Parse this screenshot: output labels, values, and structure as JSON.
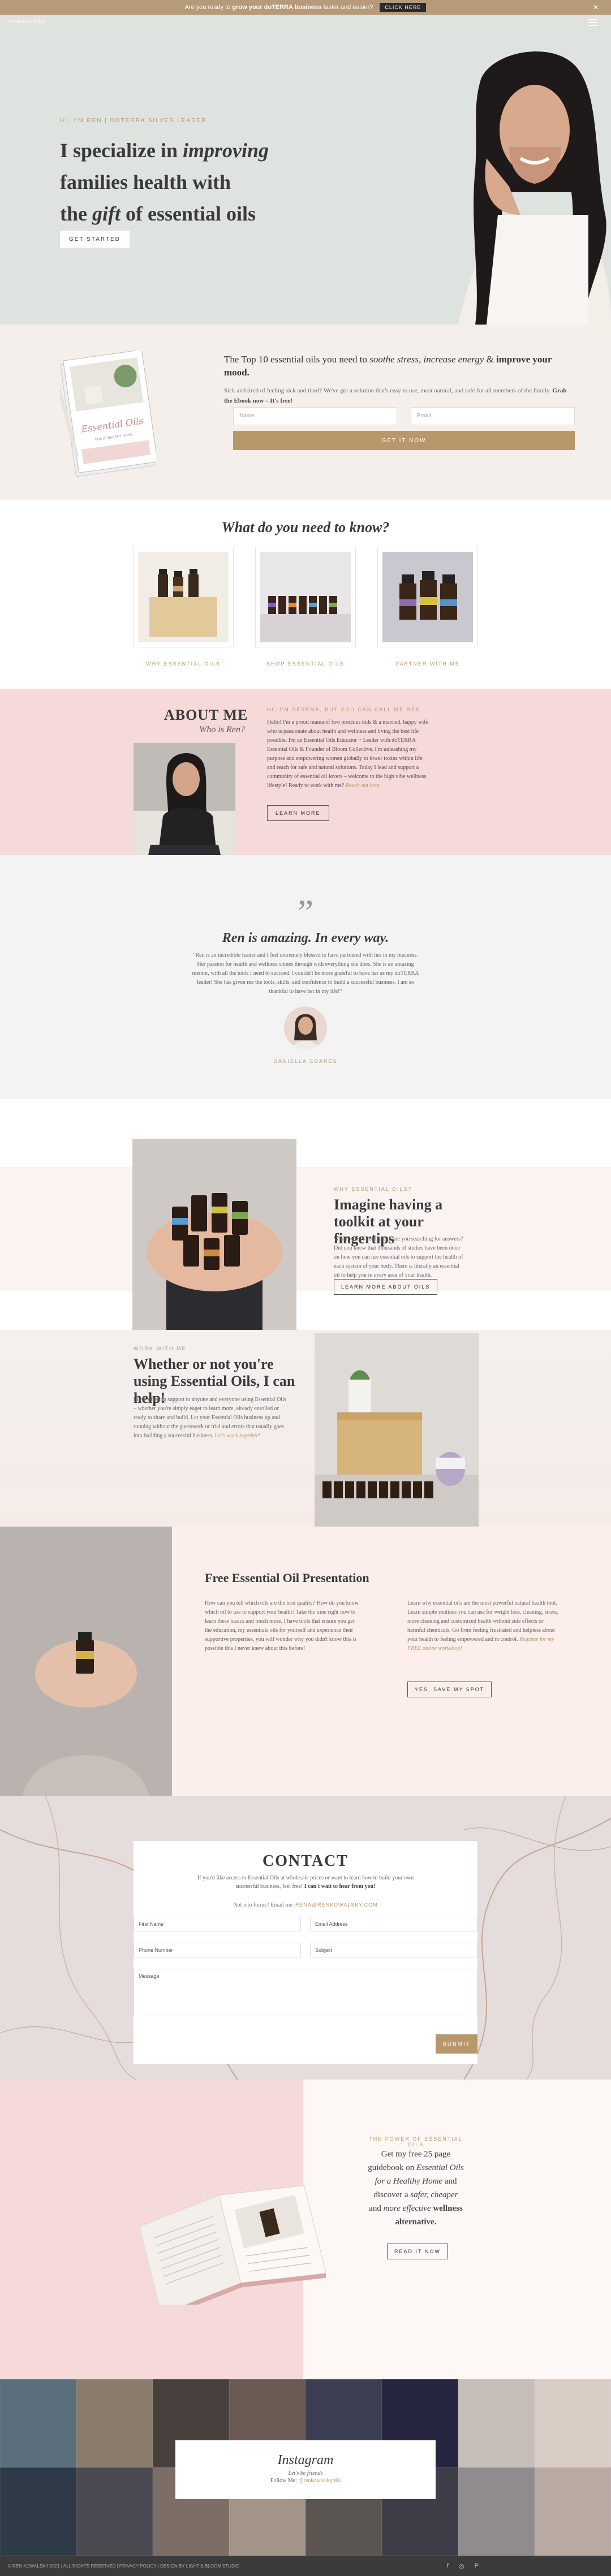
{
  "topbar": {
    "message_prefix": "Are you ready to ",
    "message_bold": "grow your doTERRA business",
    "message_suffix": " faster and easier?",
    "button": "CLICK HERE",
    "close": "✕"
  },
  "header": {
    "logo": "renkowalsky"
  },
  "hero": {
    "eyebrow": "HI, I'M REN | DOTERRA SILVER LEADER",
    "line1": "I specialize in ",
    "line1_em": "improving",
    "line2": "families health with",
    "line3a": "the ",
    "line3_em": "gift",
    "line3b": " of essential oils",
    "button": "GET STARTED"
  },
  "ebook": {
    "cover_title": "Essential Oils",
    "cover_sub": "FOR A HEALTHY HOME",
    "title_a": "The Top 10 essential oils you need to ",
    "title_em": "soothe stress, increase energy",
    "title_b": " & ",
    "title_bold": "improve your mood.",
    "desc": "Sick and tired of feeling sick and tired? We've got a solution that's easy to use, most natural, and safe for all members of the family. ",
    "desc_bold": "Grab the Ebook now – It's free!",
    "name_placeholder": "Name",
    "email_placeholder": "Email",
    "button": "GET IT NOW"
  },
  "know": {
    "heading": "What do you need to know?",
    "cards": [
      {
        "label": "WHY ESSENTIAL OILS"
      },
      {
        "label": "SHOP ESSENTIAL OILS"
      },
      {
        "label": "PARTNER WITH ME"
      }
    ]
  },
  "about": {
    "title": "ABOUT ME",
    "subtitle": "Who is Ren?",
    "eyebrow": "HI, I'M SERENA, BUT YOU CAN CALL ME REN.",
    "text": "Hello! I'm a proud mama of two precious kids & a married, happy wife who is passionate about health and wellness and living the best life possible. I'm an Essential Oils Educator + Leader with doTERRA Essential Oils & Founder of Bloom Collective. I'm unleashing my purpose and empowering women globally to lower toxins within life and reach for safe and natural solutions. Today I lead and support a community of essential oil lovers – welcome to the high vibe wellness lifestyle! Ready to work with me? ",
    "text_link": "Reach out here",
    "button": "LEARN MORE"
  },
  "testimonial": {
    "quote": "”",
    "heading": "Ren is amazing. In every way.",
    "text": "\"Ren is an incredible leader and I feel extremely blessed to have partnered with her in my business. Her passion for health and wellness shines through with everything she does. She is an amazing mentor, with all the tools I need to succeed. I couldn't be more grateful to have her as my doTERRA leader! She has given me the tools, skills, and confidence to build a successful business. I am so thankful to have her in my life!\"",
    "name": "DANIELLA SOARES"
  },
  "toolkit": {
    "eyebrow": "WHY ESSENTIAL OILS?",
    "title": "Imagine having a toolkit at your fingertips",
    "text": "Which one of your health are you searching for answers? Did you know that thousands of studies have been done on how you can use essential oils to support the health of each system of your body. There is literally an essential oil to help you in every area of your health.",
    "button": "LEARN MORE ABOUT OILS"
  },
  "work": {
    "eyebrow": "WORK WITH ME",
    "title": "Whether or not you're using Essential Oils, I can help!",
    "text": "I love offering support to anyone and everyone using Essential Oils – whether you're simply eager to learn more, already enrolled or ready to share and build. Let your Essential Oils business up and running without the guesswork or trial and errors that usually goes into building a successful business. ",
    "text_link": "Let's work together!"
  },
  "presentation": {
    "title": "Free Essential Oil Presentation",
    "col1": "How can you tell which oils are the best quality? How do you know which oil to use to support your health? Take the time right now to learn these basics and much more. I have tools that ensure you get the education, my essentials oils for yourself and experience their supportive properties, you will wonder why you didn't know this is possible this I never knew about this before!",
    "col2": "Learn why essential oils are the most powerful natural health tool. Learn simple routines you can use for weight loss, cleaning, stress, more cleaning and customized health without side effects or harmful chemicals. Go from feeling frustrated and helpless about your health to feeling empowered and in control. ",
    "col2_link": "Register for my FREE online workshop!",
    "button": "YES, SAVE MY SPOT"
  },
  "contact": {
    "title": "CONTACT",
    "text": "If you'd like access to Essential Oils at wholesale prices or want to learn how to build your own successful business, feel free! ",
    "text_bold": "I can't wait to hear from you!",
    "email_prefix": "Not into forms? Email me: ",
    "email": "RENA@RENKOWALSKY.COM",
    "first_name": "First Name",
    "email_address": "Email Address",
    "phone": "Phone Number",
    "subject": "Subject",
    "message": "Message",
    "submit": "SUBMIT"
  },
  "guide": {
    "eyebrow": "THE POWER OF ESSENTIAL OILS",
    "t1": "Get my free 25 page guidebook on ",
    "t1_em": "Essential Oils for a Healthy Home",
    "t2": " and discover a ",
    "t2_em": "safer, cheaper",
    "t3": " and ",
    "t3_em": "more effective",
    "t4": " ",
    "t4_bold": "wellness alternative.",
    "button": "READ IT NOW"
  },
  "instagram": {
    "title": "Instagram",
    "subtitle": "Let's be friends",
    "follow_prefix": "Follow Me: ",
    "handle": "@renkowalskyoils"
  },
  "footer": {
    "text": "© REN KOWALSKY 2021 | ALL RIGHTS RESERVED | PRIVACY POLICY | DESIGN BY LIGHT & BLOOM STUDIO",
    "icons": [
      "facebook-icon",
      "instagram-icon",
      "pinterest-icon"
    ]
  },
  "colors": {
    "gold": "#b8976a",
    "blush": "#f6d9d9",
    "sage": "#dfe3df",
    "dark": "#3a3a3a"
  }
}
